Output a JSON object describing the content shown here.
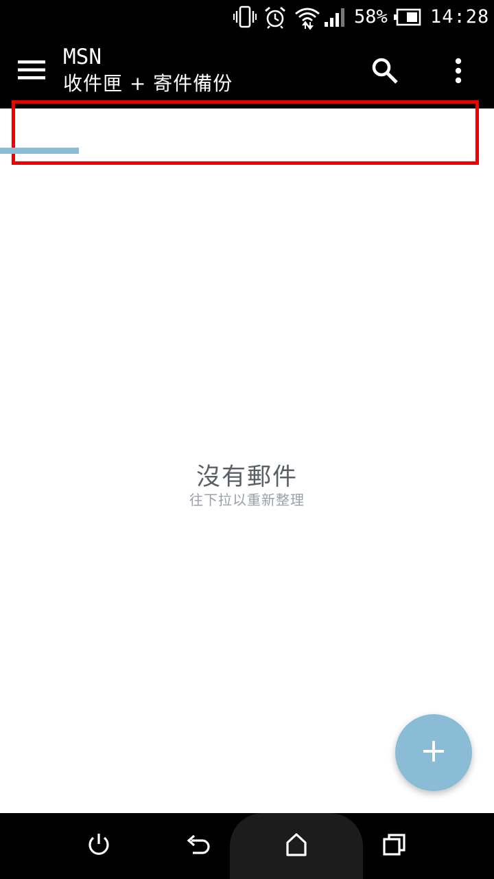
{
  "status_bar": {
    "battery_percent": "58%",
    "time": "14:28",
    "icons": [
      "vibrate-icon",
      "alarm-icon",
      "wifi-icon",
      "signal-icon",
      "battery-icon"
    ]
  },
  "app_bar": {
    "title": "MSN",
    "subtitle": "收件匣 + 寄件備份",
    "icons": [
      "menu-icon",
      "search-icon",
      "more-vert-icon"
    ]
  },
  "empty_state": {
    "title": "沒有郵件",
    "hint": "往下拉以重新整理"
  },
  "fab": {
    "icon": "plus-icon"
  },
  "nav_bar": {
    "icons": [
      "power-icon",
      "back-icon",
      "home-icon",
      "recents-icon"
    ]
  },
  "colors": {
    "accent": "#8bbcd6",
    "highlight": "#ee0000",
    "bar_background": "#000000",
    "empty_title": "#5a5f66",
    "empty_hint": "#9aa0a8"
  },
  "refresh_progress": 0.16
}
